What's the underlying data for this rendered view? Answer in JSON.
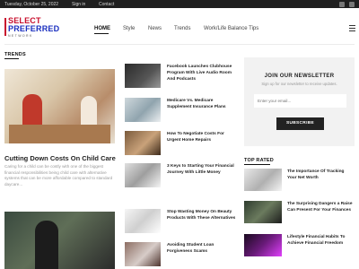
{
  "topbar": {
    "date": "Tuesday, October 25, 2022",
    "signin": "Sign in",
    "contact": "Contact",
    "icons": [
      "facebook-icon",
      "instagram-icon"
    ]
  },
  "brand": {
    "line1": "SELECT",
    "line2": "PREFERRED",
    "line3": "NETWORK",
    "accent": "#c8102e",
    "secondary": "#1a2fbf"
  },
  "nav": [
    "HOME",
    "Style",
    "News",
    "Trends",
    "Work/Life Balance Tips"
  ],
  "sections": {
    "trends": "TRENDS",
    "top_rated": "TOP RATED"
  },
  "featured": {
    "title": "Cutting Down Costs On Child Care",
    "excerpt": "Caring for a child can be costly with one of the biggest financial responsibilities being child care with alternative systems that can be more affordable compared to standard daycare..."
  },
  "list_items": [
    "Facebook Launches Clubhouse Program With Live Audio Room And Podcasts",
    "Medicare Vs. Medicare Supplement Insurance Plans",
    "How To Negotiate Costs For Urgent Home Repairs",
    "3 Keys to Starting Your Financial Journey With Little Money",
    "Stop Wasting Money On Beauty Products With These Alternatives",
    "Avoiding Student Loan Forgiveness Scams"
  ],
  "newsletter": {
    "title": "JOIN OUR NEWSLETTER",
    "subtitle": "Sign up for our newsletter to receive updates.",
    "placeholder": "Enter your email...",
    "button": "SUBSCRIBE"
  },
  "top_rated": [
    "The Importance Of Tracking Your Net Worth",
    "The Surprising Dangers a Raise Can Present For Your Finances",
    "Lifestyle Financial Habits To Achieve Financial Freedom"
  ]
}
